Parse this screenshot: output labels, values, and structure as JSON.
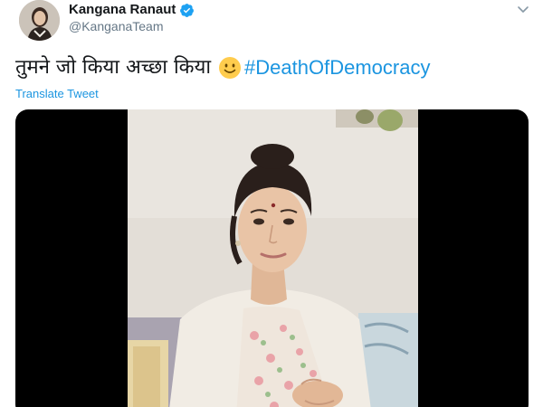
{
  "author": {
    "display_name": "Kangana Ranaut",
    "handle": "@KanganaTeam",
    "verified": true
  },
  "tweet": {
    "text": "तुमने जो किया अच्छा किया",
    "emoji": "slightly-smiling-face-icon",
    "hashtag": "#DeathOfDemocracy",
    "translate_label": "Translate Tweet"
  },
  "colors": {
    "link": "#1b95e0",
    "handle": "#657786",
    "text": "#14171a",
    "media_background": "#000000"
  },
  "icons": {
    "verified": "verified-badge-icon",
    "menu": "chevron-down-icon"
  },
  "media": {
    "type": "video",
    "subject": "woman seated on sofa speaking to camera"
  }
}
